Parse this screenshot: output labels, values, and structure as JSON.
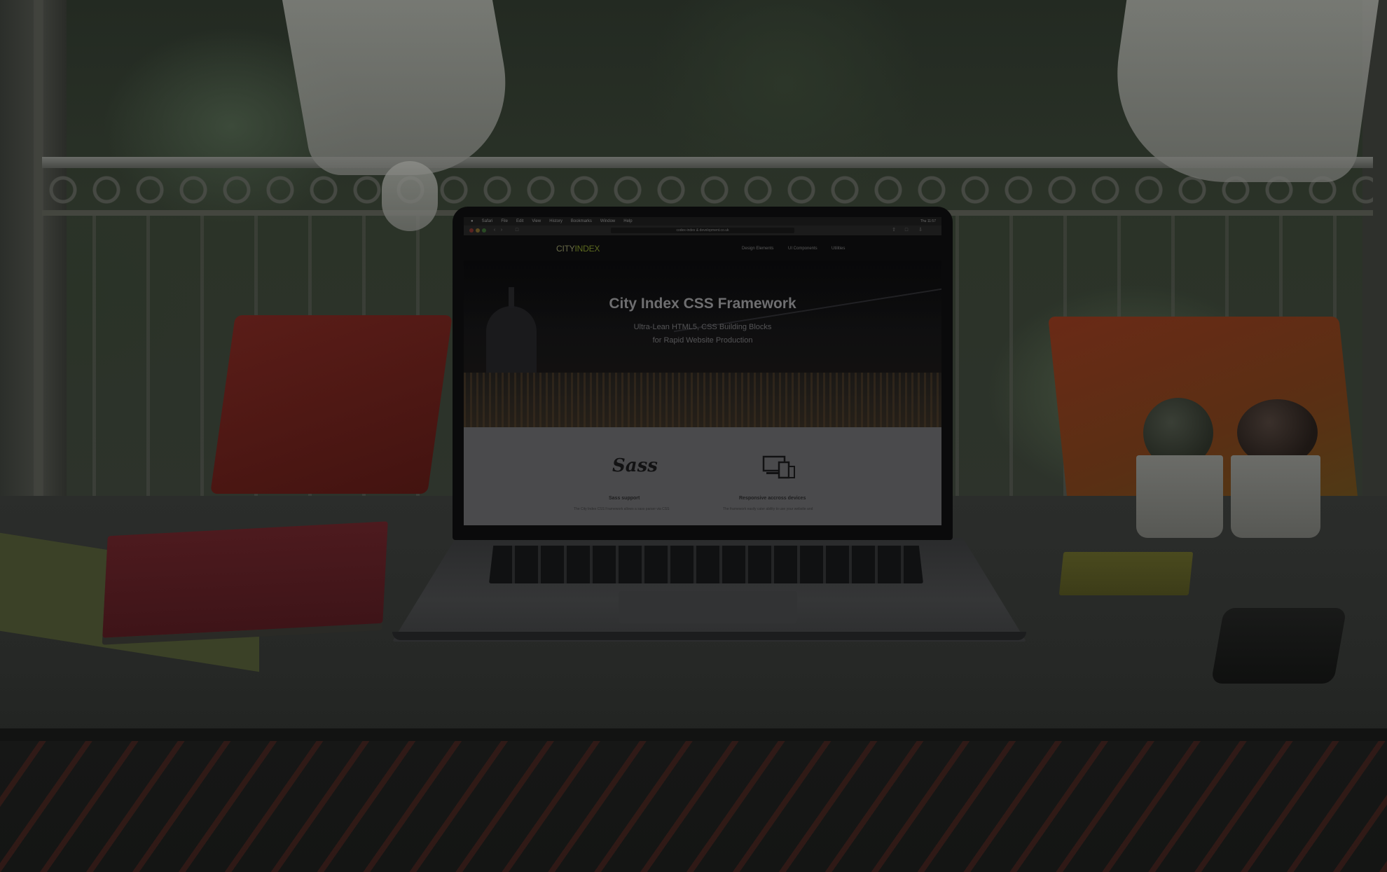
{
  "menubar": {
    "app": "Safari",
    "items": [
      "File",
      "Edit",
      "View",
      "History",
      "Bookmarks",
      "Window",
      "Help"
    ],
    "tray": "Thu 11:57"
  },
  "browser": {
    "url": "codex-index & development.co.uk"
  },
  "site": {
    "logo_left": "CITY",
    "logo_right": "INDEX",
    "logo_accent": "#5d6a1f",
    "nav": [
      "Design Elements",
      "UI Components",
      "Utilities"
    ],
    "hero_title": "City Index CSS Framework",
    "hero_sub_line1": "Ultra-Lean HTML5, CSS Building Blocks",
    "hero_sub_line2": "for Rapid Website Production",
    "features": [
      {
        "icon": "sass-logo-icon",
        "glyph": "Sass",
        "title": "Sass support",
        "text": "The City Index CSS Framework allows a sass parser via CSS"
      },
      {
        "icon": "responsive-devices-icon",
        "title": "Responsive accross devices",
        "text": "The framework easily cater ability to use your website and"
      }
    ]
  }
}
